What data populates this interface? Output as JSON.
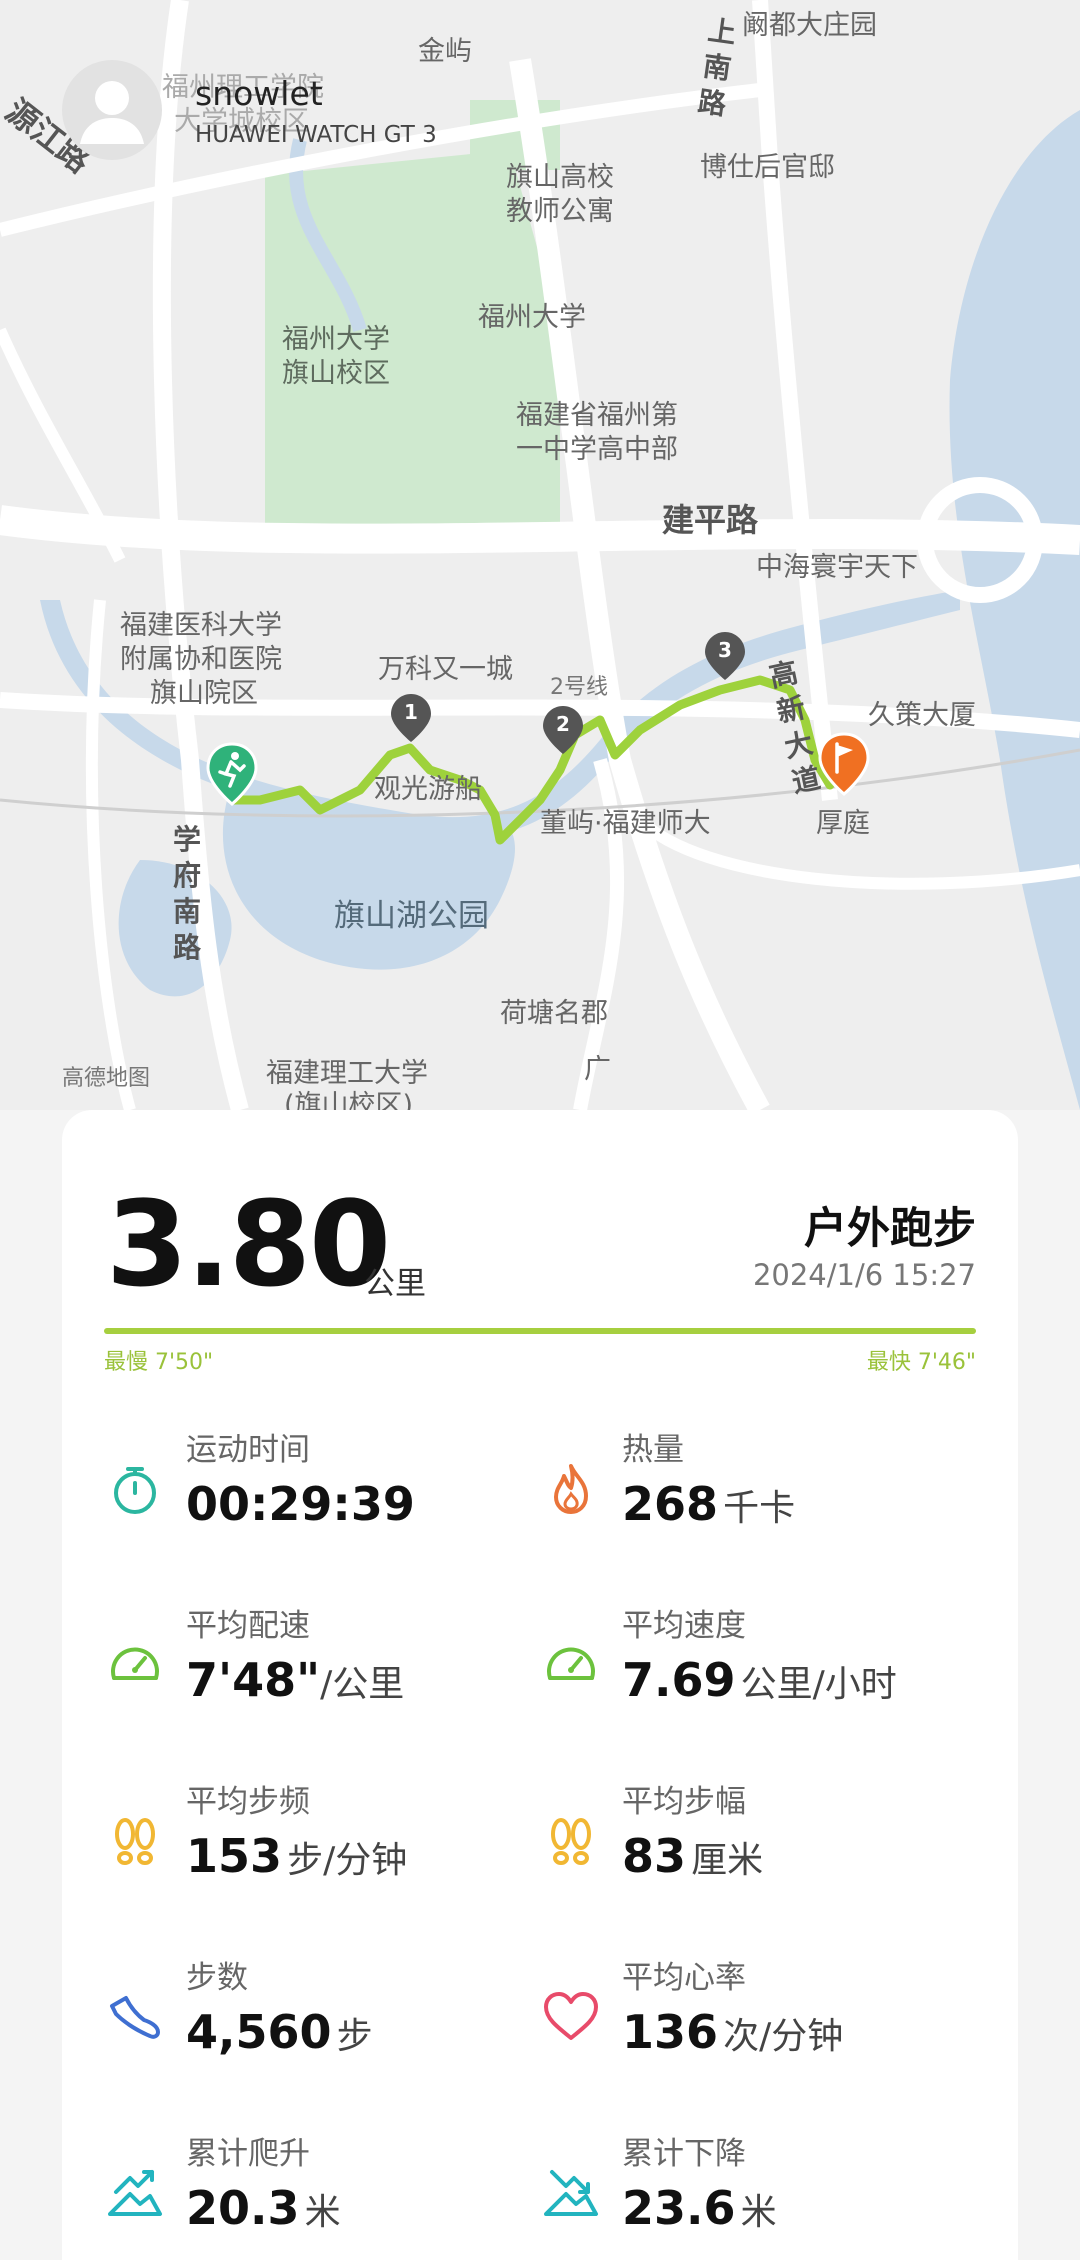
{
  "user": {
    "name": "snowlet",
    "device": "HUAWEI WATCH GT 3"
  },
  "map": {
    "source": "高德地图",
    "labels": [
      "阚都大庄园",
      "金屿",
      "源江路",
      "福州理工学院",
      "大学城校区",
      "上南路",
      "博仕后官邸",
      "旗山高校",
      "教师公寓",
      "福州大学",
      "福州大学",
      "旗山校区",
      "福建省福州第",
      "一中学高中部",
      "建平路",
      "中海寰宇天下",
      "福建医科大学",
      "附属协和医院",
      "旗山院区",
      "万科又一城",
      "2号线",
      "观光游船",
      "董屿·福建师大",
      "厚庭",
      "久策大厦",
      "高新大道",
      "学府南路",
      "旗山湖公园",
      "荷塘名郡",
      "福建理工大学",
      "(旗山校区)",
      "广"
    ],
    "markers": [
      "1",
      "2",
      "3"
    ],
    "route_color": "#9ed23c",
    "start_color": "#2fb27a",
    "end_color": "#f07022"
  },
  "summary": {
    "distance": "3.80",
    "distance_unit": "公里",
    "sport_type": "户外跑步",
    "datetime": "2024/1/6 15:27",
    "slowest": "最慢 7'50\"",
    "fastest": "最快 7'46\""
  },
  "stats": [
    {
      "icon": "stopwatch-icon",
      "label": "运动时间",
      "value": "00:29:39",
      "unit": "",
      "color": "#2bb6a0"
    },
    {
      "icon": "flame-icon",
      "label": "热量",
      "value": "268",
      "unit": "千卡",
      "color": "#e9743a"
    },
    {
      "icon": "speedometer-icon",
      "label": "平均配速",
      "value": "7'48\"",
      "unit": "/公里",
      "color": "#6cc23d"
    },
    {
      "icon": "speedometer-icon",
      "label": "平均速度",
      "value": "7.69",
      "unit": "公里/小时",
      "color": "#6cc23d"
    },
    {
      "icon": "footprints-icon",
      "label": "平均步频",
      "value": "153",
      "unit": "步/分钟",
      "color": "#f1b733"
    },
    {
      "icon": "footprints-icon",
      "label": "平均步幅",
      "value": "83",
      "unit": "厘米",
      "color": "#f1b733"
    },
    {
      "icon": "shoe-icon",
      "label": "步数",
      "value": "4,560",
      "unit": "步",
      "color": "#3f6fd1"
    },
    {
      "icon": "heart-icon",
      "label": "平均心率",
      "value": "136",
      "unit": "次/分钟",
      "color": "#e84b6a"
    },
    {
      "icon": "climb-up-icon",
      "label": "累计爬升",
      "value": "20.3",
      "unit": "米",
      "color": "#22b4bf"
    },
    {
      "icon": "climb-down-icon",
      "label": "累计下降",
      "value": "23.6",
      "unit": "米",
      "color": "#22b4bf"
    }
  ]
}
